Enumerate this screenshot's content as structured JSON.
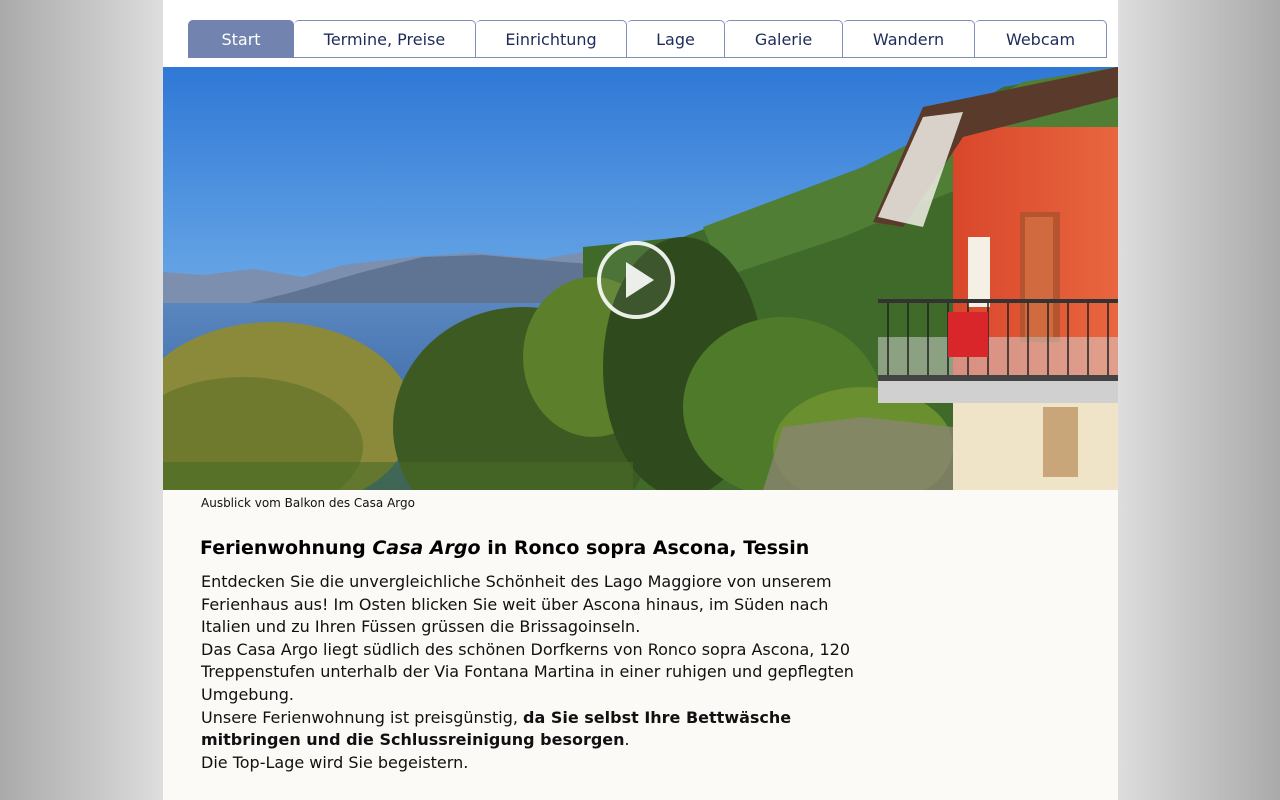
{
  "nav": {
    "tabs": [
      {
        "label": "Start",
        "active": true
      },
      {
        "label": "Termine, Preise",
        "active": false
      },
      {
        "label": "Einrichtung",
        "active": false
      },
      {
        "label": "Lage",
        "active": false
      },
      {
        "label": "Galerie",
        "active": false
      },
      {
        "label": "Wandern",
        "active": false
      },
      {
        "label": "Webcam",
        "active": false
      }
    ]
  },
  "hero": {
    "play_icon": "play-circle-icon",
    "caption": "Ausblick vom Balkon des Casa Argo"
  },
  "article": {
    "title_pre": "Ferienwohnung ",
    "title_italic": "Casa Argo",
    "title_post": " in Ronco sopra Ascona, Tessin",
    "p1": "Entdecken Sie die unvergleichliche Schönheit des Lago Maggiore von unserem Ferienhaus aus!  Im Osten blicken Sie weit über Ascona hinaus, im Süden nach Italien und zu Ihren Füssen grüssen die Brissagoinseln.",
    "p2": "Das Casa Argo liegt südlich des schönen Dorfkerns von Ronco sopra Ascona, 120 Treppenstufen unterhalb der Via Fontana Martina in einer ruhigen und gepflegten Umgebung.",
    "p3_pre": "Unsere Ferienwohnung ist preisgünstig, ",
    "p3_bold": "da Sie selbst Ihre Bettwäsche mitbringen und die Schlussreinigung besorgen",
    "p3_post": ".",
    "p4": "Die Top-Lage wird Sie begeistern."
  },
  "colors": {
    "tab_active": "#7183ae",
    "tab_border": "#7f8fb8",
    "tab_text": "#1d2b5a",
    "page_bg": "#fbfaf7"
  }
}
